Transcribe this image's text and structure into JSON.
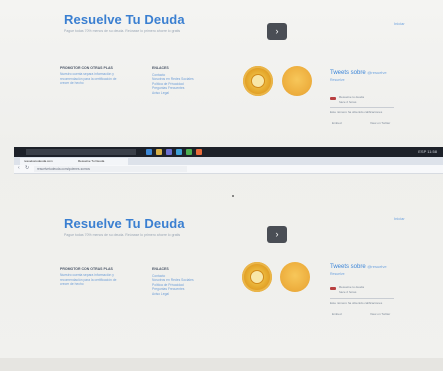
{
  "hero": {
    "title": "Resuelve Tu Deuda",
    "subtitle": "Pague todas 70% menos de su deuda. Reúnase lo primero ahorre lo gratis",
    "top_link": "Iniciar"
  },
  "columns": {
    "left": {
      "heading": "PROMOTOR CON OTRAS PLAS",
      "text": "Nuestro cuenta separa información y recomendación para la certificación de crecer de hecho"
    },
    "links": {
      "heading": "ENLACES",
      "items": [
        "Contacto",
        "Nosotros en Redes Sociales",
        "Política de Privacidad",
        "Preguntas Frecuentes",
        "Aviso Legal"
      ]
    }
  },
  "badges": [
    "seal-badge",
    "gold-badge"
  ],
  "review": {
    "title": "Tweets sobre",
    "handle": "@resuelve",
    "sub": "Resuelve",
    "item_text": "Resuelve tu deuda",
    "item_meta": "hace 2 horas",
    "note": "Este número ha obtenido calificaciones",
    "footer_left": "Embed",
    "footer_right": "View on Twitter"
  },
  "browser": {
    "tab_1": "resuelvetudeuda.com",
    "tab_2": "Resuelve Tu Deuda",
    "url": "resuelvetudeuda.com/quienes-somos",
    "tray": "ESP 11:58",
    "search_placeholder": "Escribe aquí para buscar"
  },
  "colors": {
    "brand_blue": "#3a7fd1",
    "button_dark": "#4a4e55",
    "badge_gold": "#e4a52a",
    "taskbar": "#1d2129"
  }
}
